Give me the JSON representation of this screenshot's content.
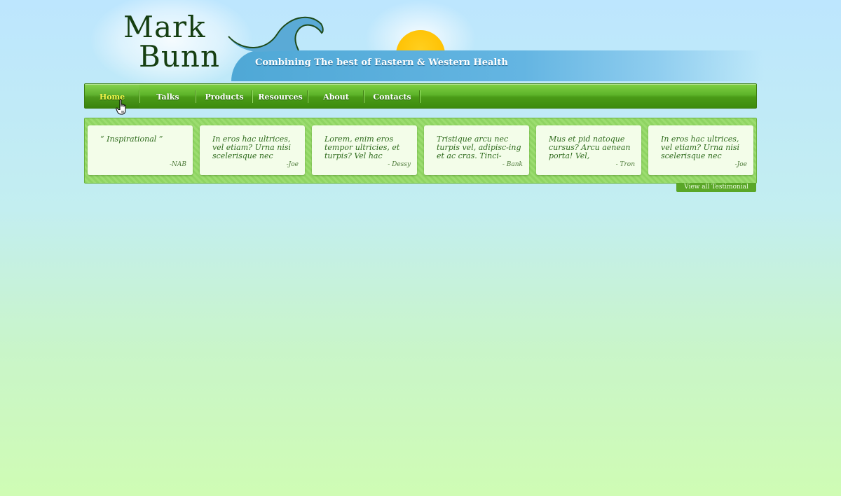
{
  "brand": {
    "logo_line1": "Mark",
    "logo_line2": "Bunn",
    "tagline": "Combining The best of Eastern & Western Health"
  },
  "nav": {
    "items": [
      {
        "label": "Home",
        "active": true
      },
      {
        "label": "Talks",
        "active": false
      },
      {
        "label": "Products",
        "active": false
      },
      {
        "label": "Resources",
        "active": false
      },
      {
        "label": "About",
        "active": false
      },
      {
        "label": "Contacts",
        "active": false
      }
    ],
    "cursor_icon": "hand-pointer-icon"
  },
  "testimonials": {
    "items": [
      {
        "text": "“ Inspirational ”",
        "author": "-NAB"
      },
      {
        "text": "In eros hac ultrices, vel etiam? Urna nisi scelerisque nec",
        "author": "-Joe"
      },
      {
        "text": "Lorem, enim eros tempor ultricies, et turpis? Vel hac",
        "author": "- Dessy"
      },
      {
        "text": "Tristique arcu nec turpis vel, adipisc-ing et ac cras. Tinci-",
        "author": "- Bank"
      },
      {
        "text": "Mus et pid natoque cursus? Arcu aenean porta! Vel,",
        "author": "- Tron"
      },
      {
        "text": "In eros hac ultrices, vel etiam? Urna nisi scelerisque nec",
        "author": "-Joe"
      }
    ],
    "view_all_label": "View all Testimonial"
  },
  "colors": {
    "nav_green": "#4a9b17",
    "active_nav_text": "#f4f64a",
    "sun": "#ffc000",
    "wave": "#4fa8d6",
    "logo_text": "#163f12"
  }
}
